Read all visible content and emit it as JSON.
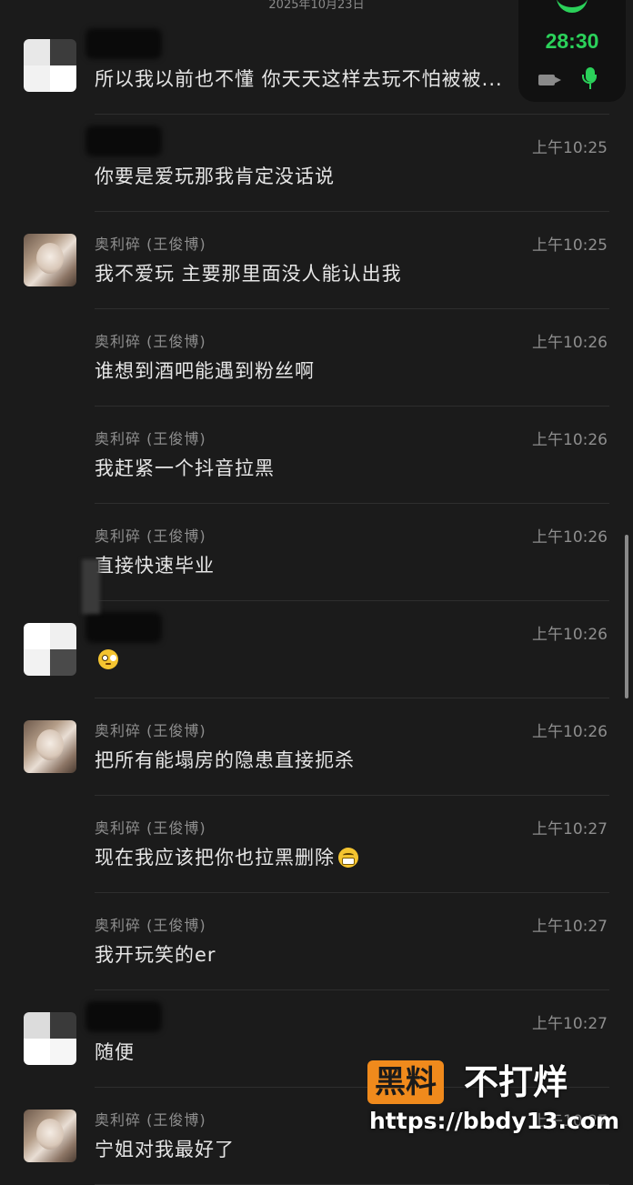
{
  "date_header": "2025年10月23日",
  "call": {
    "timer": "28:30"
  },
  "messages": [
    {
      "sender": "",
      "time": "",
      "text": "所以我以前也不懂 你天天这样去玩不怕被被...",
      "avatar": "mosaic"
    },
    {
      "sender": "",
      "time": "上午10:25",
      "text": "你要是爱玩那我肯定没话说",
      "avatar": "none"
    },
    {
      "sender": "奥利碎 (王俊博)",
      "time": "上午10:25",
      "text": "我不爱玩 主要那里面没人能认出我",
      "avatar": "photo"
    },
    {
      "sender": "奥利碎 (王俊博)",
      "time": "上午10:26",
      "text": "谁想到酒吧能遇到粉丝啊",
      "avatar": "none"
    },
    {
      "sender": "奥利碎 (王俊博)",
      "time": "上午10:26",
      "text": "我赶紧一个抖音拉黑",
      "avatar": "none"
    },
    {
      "sender": "奥利碎 (王俊博)",
      "time": "上午10:26",
      "text": "直接快速毕业",
      "avatar": "none"
    },
    {
      "sender": "",
      "time": "上午10:26",
      "text": "",
      "emoji": "flushed-face",
      "avatar": "mosaic"
    },
    {
      "sender": "奥利碎 (王俊博)",
      "time": "上午10:26",
      "text": "把所有能塌房的隐患直接扼杀",
      "avatar": "photo"
    },
    {
      "sender": "奥利碎 (王俊博)",
      "time": "上午10:27",
      "text": "现在我应该把你也拉黑删除",
      "emoji": "grinning-face",
      "avatar": "none"
    },
    {
      "sender": "奥利碎 (王俊博)",
      "time": "上午10:27",
      "text": "我开玩笑的er",
      "avatar": "none"
    },
    {
      "sender": "",
      "time": "上午10:27",
      "text": "随便",
      "avatar": "mosaic"
    },
    {
      "sender": "奥利碎 (王俊博)",
      "time": "上午10:27",
      "text": "宁姐对我最好了",
      "avatar": "photo"
    }
  ],
  "watermark": {
    "brand_box": "黑料",
    "brand_tail": "不打烊",
    "url": "https://bbdy13.com",
    "color": "#f08a1c"
  }
}
